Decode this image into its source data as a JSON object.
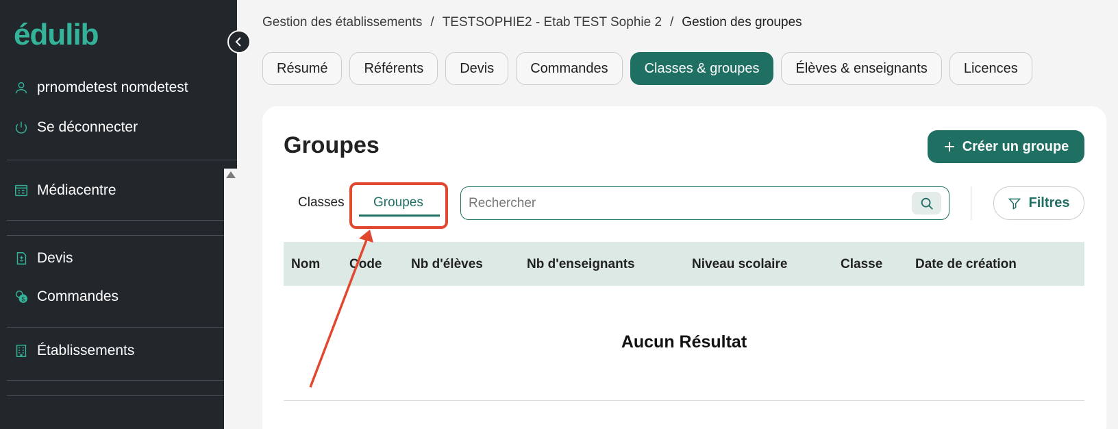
{
  "sidebar": {
    "logo": "édulib",
    "user_name": "prnomdetest nomdetest",
    "logout": "Se déconnecter",
    "items": [
      {
        "label": "Médiacentre",
        "icon": "mediacentre-icon"
      },
      {
        "label": "Devis",
        "icon": "document-icon"
      },
      {
        "label": "Commandes",
        "icon": "coins-icon"
      },
      {
        "label": "Établissements",
        "icon": "building-icon"
      }
    ]
  },
  "breadcrumb": {
    "items": [
      "Gestion des établissements",
      "TESTSOPHIE2 - Etab TEST Sophie 2",
      "Gestion des groupes"
    ],
    "separator": "/"
  },
  "tabs": [
    {
      "label": "Résumé",
      "active": false
    },
    {
      "label": "Référents",
      "active": false
    },
    {
      "label": "Devis",
      "active": false
    },
    {
      "label": "Commandes",
      "active": false
    },
    {
      "label": "Classes & groupes",
      "active": true
    },
    {
      "label": "Élèves & enseignants",
      "active": false
    },
    {
      "label": "Licences",
      "active": false
    }
  ],
  "main": {
    "title": "Groupes",
    "create_button": "Créer un groupe",
    "subtabs": {
      "classes": "Classes",
      "groupes": "Groupes"
    },
    "search_placeholder": "Rechercher",
    "filter_button": "Filtres",
    "columns": [
      "Nom",
      "Code",
      "Nb d'élèves",
      "Nb d'enseignants",
      "Niveau scolaire",
      "Classe",
      "Date de création"
    ],
    "empty_message": "Aucun Résultat"
  },
  "colors": {
    "primary": "#1f6f63",
    "sidebar_bg": "#22272b",
    "logo": "#35b39a",
    "highlight": "#e0492f",
    "table_header_bg": "#dde9e5"
  }
}
